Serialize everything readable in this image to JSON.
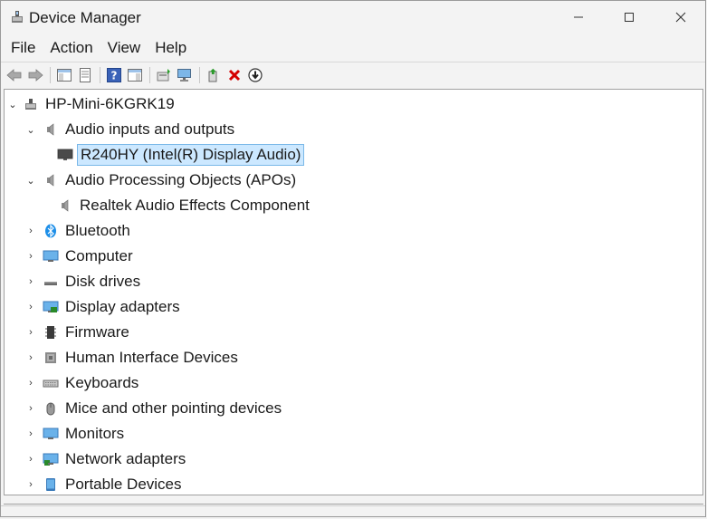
{
  "window": {
    "title": "Device Manager",
    "controls": {
      "minimize": "—",
      "maximize": "☐",
      "close": "✕"
    }
  },
  "menu": [
    {
      "label": "File"
    },
    {
      "label": "Action"
    },
    {
      "label": "View"
    },
    {
      "label": "Help"
    }
  ],
  "toolbar": {
    "buttons": [
      "back-icon",
      "forward-icon",
      "show-hide-console-tree-icon",
      "properties-icon",
      "help-icon",
      "show-hide-action-pane-icon",
      "update-driver-icon",
      "scan-hardware-icon",
      "enable-device-icon",
      "uninstall-device-icon",
      "disable-device-icon"
    ]
  },
  "tree": {
    "root": "HP-Mini-6KGRK19",
    "audio_io": {
      "label": "Audio inputs and outputs",
      "child": "R240HY (Intel(R) Display Audio)"
    },
    "apo": {
      "label": "Audio Processing Objects (APOs)",
      "child": "Realtek Audio Effects Component"
    },
    "categories": [
      "Bluetooth",
      "Computer",
      "Disk drives",
      "Display adapters",
      "Firmware",
      "Human Interface Devices",
      "Keyboards",
      "Mice and other pointing devices",
      "Monitors",
      "Network adapters",
      "Portable Devices"
    ]
  },
  "colors": {
    "selection_bg": "#cce8ff",
    "selection_border": "#7ab8e8",
    "uninstall_red": "#d40000",
    "bluetooth_blue": "#1c8ee8"
  }
}
